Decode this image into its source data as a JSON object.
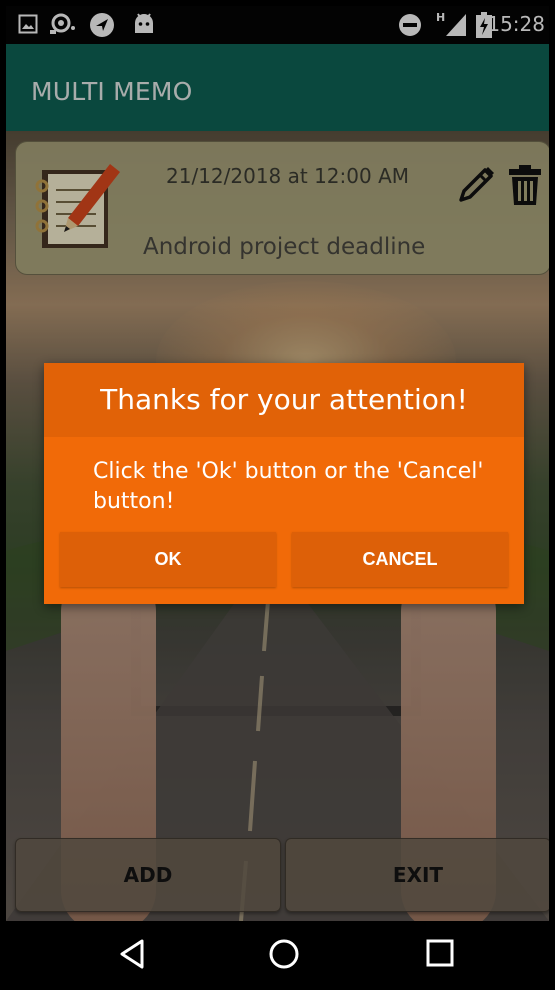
{
  "status_bar": {
    "time": "15:28",
    "icons": [
      "image-icon",
      "cast-icon",
      "location-icon",
      "android-icon",
      "do-not-disturb-icon",
      "signal-icon",
      "battery-charging-icon"
    ]
  },
  "app_bar": {
    "title": "MULTI MEMO"
  },
  "memo_list": {
    "items": [
      {
        "datetime": "21/12/2018 at 12:00 AM",
        "title": "Android project deadline",
        "icon": "notepad-icon"
      }
    ]
  },
  "dialog": {
    "title": "Thanks for your attention!",
    "message": "Click the 'Ok' button or the 'Cancel' button!",
    "ok_label": "OK",
    "cancel_label": "CANCEL"
  },
  "bottom_buttons": {
    "add_label": "ADD",
    "exit_label": "EXIT"
  },
  "nav_bar": {
    "icons": [
      "back-icon",
      "home-icon",
      "recents-icon"
    ]
  },
  "colors": {
    "app_bar": "#0f6457",
    "dialog": "#f16a08",
    "dialog_header": "#e16207"
  }
}
